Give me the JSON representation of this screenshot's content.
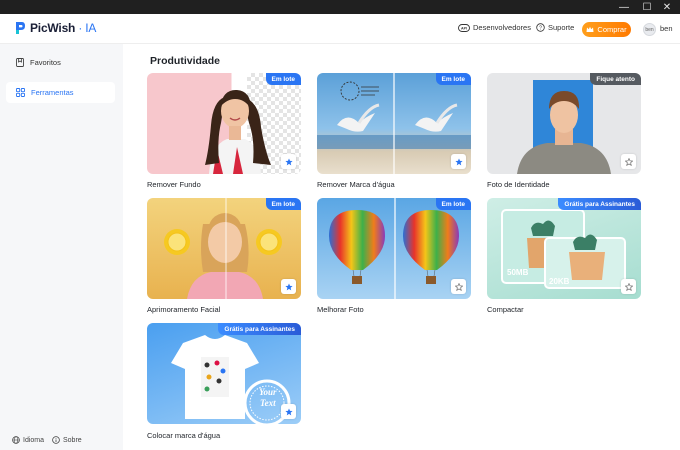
{
  "app": {
    "logo_name": "PicWish",
    "logo_suffix": "· IA"
  },
  "window": {
    "minimize": "—",
    "maximize": "☐",
    "close": "✕"
  },
  "header": {
    "developers": "Desenvolvedores",
    "support": "Suporte",
    "buy": "Comprar",
    "avatar_text": "ben",
    "user_name": "ben"
  },
  "sidebar": {
    "items": [
      {
        "label": "Favoritos",
        "icon": "bookmark-icon",
        "active": false
      },
      {
        "label": "Ferramentas",
        "icon": "grid-icon",
        "active": true
      }
    ],
    "footer": {
      "language": "Idioma",
      "about": "Sobre"
    }
  },
  "main": {
    "section_title": "Produtividade",
    "cards": [
      {
        "label": "Remover Fundo",
        "badge": "Em lote",
        "starred": true
      },
      {
        "label": "Remover Marca d'água",
        "badge": "Em lote",
        "starred": true
      },
      {
        "label": "Foto de Identidade",
        "badge": "Fique atento",
        "starred": false
      },
      {
        "label": "Aprimoramento Facial",
        "badge": "Em lote",
        "starred": true
      },
      {
        "label": "Melhorar Foto",
        "badge": "Em lote",
        "starred": false
      },
      {
        "label": "Compactar",
        "badge": "Grátis para Assinantes",
        "starred": false,
        "size_before": "50MB",
        "size_after": "20KB"
      },
      {
        "label": "Colocar marca d'água",
        "badge": "Grátis para Assinantes",
        "starred": true,
        "stamp_text_1": "Your",
        "stamp_text_2": "Text"
      }
    ]
  },
  "colors": {
    "accent": "#2a75f3",
    "buy": "#ff8a00",
    "badge_dark": "#555a60"
  }
}
